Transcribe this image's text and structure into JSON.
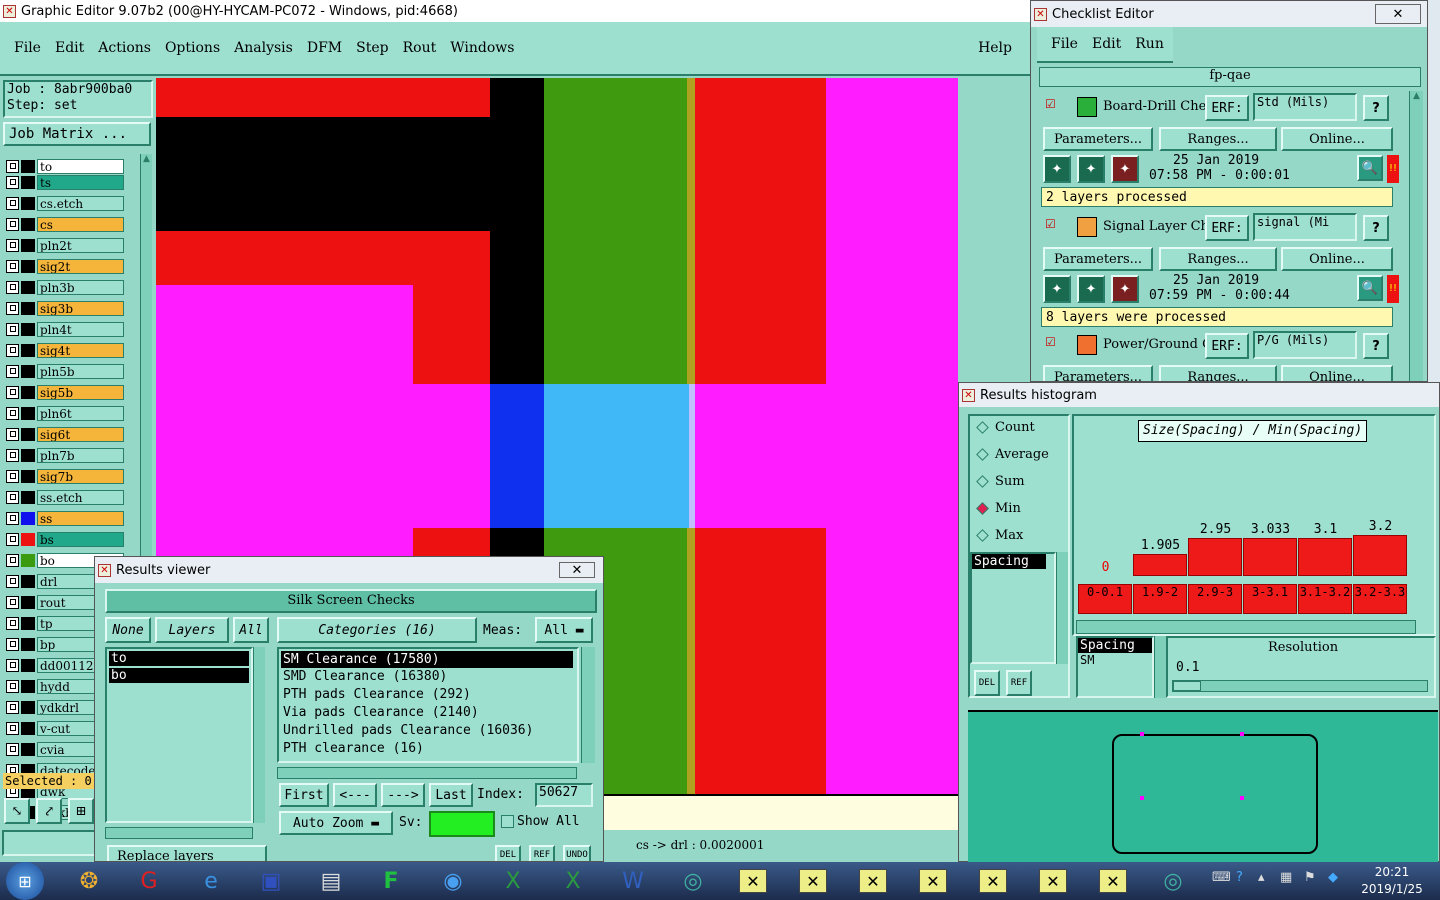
{
  "main_window": {
    "title": "Graphic Editor 9.07b2 (00@HY-HYCAM-PC072 - Windows, pid:4668)",
    "menu": [
      "File",
      "Edit",
      "Actions",
      "Options",
      "Analysis",
      "DFM",
      "Step",
      "Rout",
      "Windows"
    ],
    "help": "Help",
    "job_label": "Job : 8abr900ba0",
    "step_label": "Step: set",
    "job_matrix": "Job Matrix ...",
    "selected": "Selected : 0",
    "status": "cs -> drl : 0.0020001",
    "layers": [
      {
        "name": "to",
        "bg": "#ffffff",
        "col": "#000000"
      },
      {
        "name": "ts",
        "bg": "#21a88a",
        "col": "#000000"
      },
      {
        "name": "cs.etch",
        "bg": "#9ee0d0",
        "col": "#000000"
      },
      {
        "name": "cs",
        "bg": "#f5b53a",
        "col": "#000000"
      },
      {
        "name": "pln2t",
        "bg": "#9ee0d0",
        "col": "#000000"
      },
      {
        "name": "sig2t",
        "bg": "#f5b53a",
        "col": "#000000"
      },
      {
        "name": "pln3b",
        "bg": "#9ee0d0",
        "col": "#000000"
      },
      {
        "name": "sig3b",
        "bg": "#f5b53a",
        "col": "#000000"
      },
      {
        "name": "pln4t",
        "bg": "#9ee0d0",
        "col": "#000000"
      },
      {
        "name": "sig4t",
        "bg": "#f5b53a",
        "col": "#000000"
      },
      {
        "name": "pln5b",
        "bg": "#9ee0d0",
        "col": "#000000"
      },
      {
        "name": "sig5b",
        "bg": "#f5b53a",
        "col": "#000000"
      },
      {
        "name": "pln6t",
        "bg": "#9ee0d0",
        "col": "#000000"
      },
      {
        "name": "sig6t",
        "bg": "#f5b53a",
        "col": "#000000"
      },
      {
        "name": "pln7b",
        "bg": "#9ee0d0",
        "col": "#000000"
      },
      {
        "name": "sig7b",
        "bg": "#f5b53a",
        "col": "#000000"
      },
      {
        "name": "ss.etch",
        "bg": "#9ee0d0",
        "col": "#000000"
      },
      {
        "name": "ss",
        "bg": "#f5b53a",
        "col": "#1010ee"
      },
      {
        "name": "bs",
        "bg": "#21a88a",
        "col": "#ee1111"
      },
      {
        "name": "bo",
        "bg": "#ffffff",
        "col": "#3a9a10"
      },
      {
        "name": "drl",
        "bg": "#9ee0d0",
        "col": "#000000"
      },
      {
        "name": "rout",
        "bg": "#9ee0d0",
        "col": "#000000"
      },
      {
        "name": "tp",
        "bg": "#9ee0d0",
        "col": "#000000"
      },
      {
        "name": "bp",
        "bg": "#9ee0d0",
        "col": "#000000"
      },
      {
        "name": "dd00112",
        "bg": "#9ee0d0",
        "col": "#000000"
      },
      {
        "name": "hydd",
        "bg": "#9ee0d0",
        "col": "#000000"
      },
      {
        "name": "ydkdrl",
        "bg": "#9ee0d0",
        "col": "#000000"
      },
      {
        "name": "v-cut",
        "bg": "#9ee0d0",
        "col": "#000000"
      },
      {
        "name": "cvia",
        "bg": "#9ee0d0",
        "col": "#000000"
      },
      {
        "name": "datecode",
        "bg": "#9ee0d0",
        "col": "#000000"
      },
      {
        "name": "dwk",
        "bg": "#9ee0d0",
        "col": "#000000"
      },
      {
        "name": "dwkby",
        "bg": "#9ee0d0",
        "col": "#000000"
      }
    ]
  },
  "checklist": {
    "title": "Checklist Editor",
    "menu": [
      "File",
      "Edit",
      "Run"
    ],
    "name": "fp-qae",
    "items": [
      {
        "label": "Board-Drill Che",
        "erf": "ERF:",
        "erf_value": "Std (Mils)",
        "date": "25 Jan 2019",
        "time": "07:58 PM - 0:00:01",
        "status": "2 layers processed"
      },
      {
        "label": "Signal Layer Ch",
        "erf": "ERF:",
        "erf_value": "signal (Mi",
        "date": "25 Jan 2019",
        "time": "07:59 PM - 0:00:44",
        "status": "8 layers were processed"
      },
      {
        "label": "Power/Ground C",
        "erf": "ERF:",
        "erf_value": "P/G (Mils)",
        "date": "",
        "time": "",
        "status": ""
      }
    ],
    "buttons": {
      "parameters": "Parameters...",
      "ranges": "Ranges...",
      "online": "Online..."
    },
    "help": "?"
  },
  "results_viewer": {
    "title": "Results viewer",
    "header": "Silk Screen Checks",
    "none": "None",
    "layers": "Layers",
    "all": "All",
    "categories": "Categories (16)",
    "meas": "Meas:",
    "meas_value": "All",
    "layer_list": [
      "to",
      "bo"
    ],
    "category_list": [
      "SM Clearance (17580)",
      "SMD Clearance (16380)",
      "PTH pads Clearance (292)",
      "Via pads Clearance (2140)",
      "Undrilled pads Clearance (16036)",
      "PTH clearance (16)"
    ],
    "first": "First",
    "prev": "<---",
    "next": "--->",
    "last": "Last",
    "index_label": "Index:",
    "index_value": "50627",
    "auto_zoom": "Auto Zoom",
    "sv": "Sv:",
    "show_all": "Show All",
    "replace_layers": "Replace layers",
    "del": "DEL",
    "ref": "REF",
    "undo": "UNDO"
  },
  "histogram": {
    "title": "Results histogram",
    "modes": [
      "Count",
      "Average",
      "Sum",
      "Min",
      "Max"
    ],
    "selected_mode": "Min",
    "heading": "Size(Spacing) / Min(Spacing)",
    "list_item": "Spacing",
    "bars": [
      {
        "value": "0",
        "range": "0-0.1",
        "level": 0
      },
      {
        "value": "1.905",
        "range": "1.9-2",
        "level": 0.4
      },
      {
        "value": "2.95",
        "range": "2.9-3",
        "level": 0.7
      },
      {
        "value": "3.033",
        "range": "3-3.1",
        "level": 0.7
      },
      {
        "value": "3.1",
        "range": "3.1-3.2",
        "level": 0.7
      },
      {
        "value": "3.2",
        "range": "3.2-3.3",
        "level": 0.75
      }
    ],
    "attr_list": [
      "Spacing",
      "SM"
    ],
    "resolution_label": "Resolution",
    "resolution_value": "0.1",
    "del": "DEL",
    "ref": "REF"
  },
  "taskbar": {
    "time": "20:21",
    "date": "2019/1/25"
  }
}
